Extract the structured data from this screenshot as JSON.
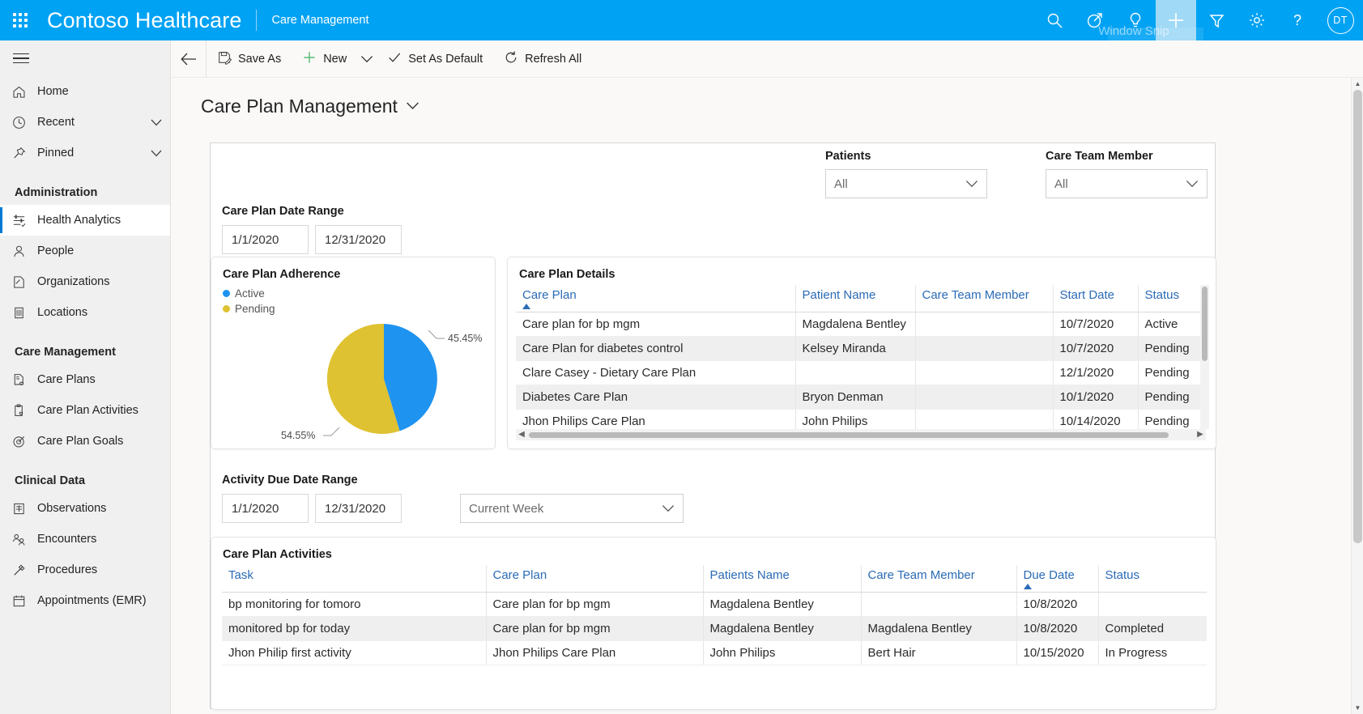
{
  "header": {
    "brand": "Contoso Healthcare",
    "app_name": "Care Management",
    "snip_tooltip": "Window Snip",
    "avatar_initials": "DT",
    "bg_color": "#00A2F3",
    "icons": [
      {
        "name": "search-icon",
        "label": "Search"
      },
      {
        "name": "diagnostics-icon",
        "label": "Diagnostics"
      },
      {
        "name": "lightbulb-icon",
        "label": "Assistant"
      },
      {
        "name": "plus-icon",
        "label": "Quick Create"
      },
      {
        "name": "filter-icon",
        "label": "Filter"
      },
      {
        "name": "gear-icon",
        "label": "Settings"
      },
      {
        "name": "help-icon",
        "label": "Help"
      }
    ]
  },
  "commandbar": {
    "back_label": "Back",
    "save_as": "Save As",
    "new": "New",
    "set_as_default": "Set As Default",
    "refresh_all": "Refresh All"
  },
  "sidebar": {
    "top_items": [
      {
        "label": "Home",
        "icon": "home-icon",
        "chevron": false
      },
      {
        "label": "Recent",
        "icon": "clock-icon",
        "chevron": true
      },
      {
        "label": "Pinned",
        "icon": "pin-icon",
        "chevron": true
      }
    ],
    "groups": [
      {
        "title": "Administration",
        "items": [
          {
            "label": "Health Analytics",
            "icon": "analytics-icon",
            "selected": true
          },
          {
            "label": "People",
            "icon": "person-icon",
            "selected": false
          },
          {
            "label": "Organizations",
            "icon": "org-icon",
            "selected": false
          },
          {
            "label": "Locations",
            "icon": "building-icon",
            "selected": false
          }
        ]
      },
      {
        "title": "Care Management",
        "items": [
          {
            "label": "Care Plans",
            "icon": "careplan-icon",
            "selected": false
          },
          {
            "label": "Care Plan Activities",
            "icon": "clipboard-heart-icon",
            "selected": false
          },
          {
            "label": "Care Plan Goals",
            "icon": "target-icon",
            "selected": false
          }
        ]
      },
      {
        "title": "Clinical Data",
        "items": [
          {
            "label": "Observations",
            "icon": "observation-icon",
            "selected": false
          },
          {
            "label": "Encounters",
            "icon": "encounters-icon",
            "selected": false
          },
          {
            "label": "Procedures",
            "icon": "syringe-icon",
            "selected": false
          },
          {
            "label": "Appointments (EMR)",
            "icon": "calendar-icon",
            "selected": false
          }
        ]
      }
    ]
  },
  "page": {
    "title": "Care Plan Management"
  },
  "filters": {
    "patients": {
      "label": "Patients",
      "value": "All"
    },
    "care_team_member": {
      "label": "Care Team Member",
      "value": "All"
    },
    "care_plan_date_range": {
      "label": "Care Plan Date Range",
      "start": "1/1/2020",
      "end": "12/31/2020"
    },
    "activity_due_date_range": {
      "label": "Activity Due Date Range",
      "start": "1/1/2020",
      "end": "12/31/2020",
      "preset": "Current Week"
    }
  },
  "adherence_card": {
    "title": "Care Plan Adherence"
  },
  "chart_data": {
    "type": "pie",
    "title": "Care Plan Adherence",
    "categories": [
      "Active",
      "Pending"
    ],
    "values": [
      45.45,
      54.55
    ],
    "labels": [
      "45.45%",
      "54.55%"
    ],
    "colors": [
      "#1F93F0",
      "#DFC231"
    ],
    "legend_position": "top-left",
    "unit": "%"
  },
  "care_plan_details": {
    "title": "Care Plan Details",
    "columns": [
      "Care Plan",
      "Patient Name",
      "Care Team Member",
      "Start Date",
      "Status"
    ],
    "sorted_column": "Care Plan",
    "sort_direction": "ascending",
    "rows": [
      {
        "care_plan": "Care plan for bp mgm",
        "patient_name": "Magdalena Bentley",
        "care_team_member": "",
        "start_date": "10/7/2020",
        "status": "Active"
      },
      {
        "care_plan": "Care Plan for diabetes control",
        "patient_name": "Kelsey Miranda",
        "care_team_member": "",
        "start_date": "10/7/2020",
        "status": "Pending"
      },
      {
        "care_plan": "Clare Casey - Dietary Care Plan",
        "patient_name": "",
        "care_team_member": "",
        "start_date": "12/1/2020",
        "status": "Pending"
      },
      {
        "care_plan": "Diabetes Care Plan",
        "patient_name": "Bryon Denman",
        "care_team_member": "",
        "start_date": "10/1/2020",
        "status": "Pending"
      },
      {
        "care_plan": "Jhon Philips Care Plan",
        "patient_name": "John Philips",
        "care_team_member": "",
        "start_date": "10/14/2020",
        "status": "Pending"
      }
    ]
  },
  "care_plan_activities": {
    "title": "Care Plan Activities",
    "columns": [
      "Task",
      "Care Plan",
      "Patients Name",
      "Care Team Member",
      "Due Date",
      "Status"
    ],
    "sorted_column": "Due Date",
    "sort_direction": "ascending",
    "rows": [
      {
        "task": "bp monitoring for tomoro",
        "care_plan": "Care plan for bp mgm",
        "patients_name": "Magdalena Bentley",
        "care_team_member": "",
        "due_date": "10/8/2020",
        "status": ""
      },
      {
        "task": "monitored bp for today",
        "care_plan": "Care plan for bp mgm",
        "patients_name": "Magdalena Bentley",
        "care_team_member": "Magdalena Bentley",
        "due_date": "10/8/2020",
        "status": "Completed"
      },
      {
        "task": "Jhon Philip first activity",
        "care_plan": "Jhon Philips Care Plan",
        "patients_name": "John Philips",
        "care_team_member": "Bert Hair",
        "due_date": "10/15/2020",
        "status": "In Progress"
      }
    ]
  }
}
